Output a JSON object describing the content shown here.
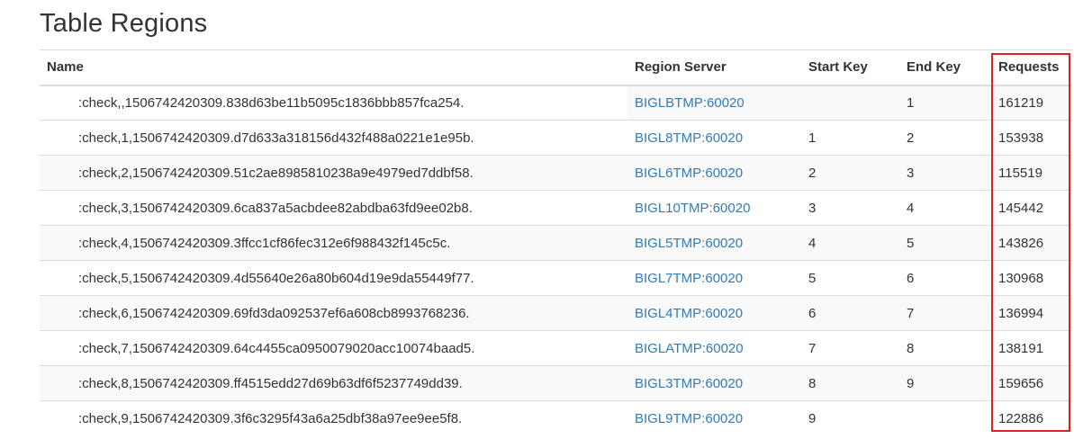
{
  "page_title": "Table Regions",
  "columns": {
    "name": "Name",
    "region_server": "Region Server",
    "start_key": "Start Key",
    "end_key": "End Key",
    "requests": "Requests"
  },
  "rows": [
    {
      "name": ":check,,1506742420309.838d63be11b5095c1836bbb857fca254.",
      "server": "BIGLBTMP:60020",
      "start_key": "",
      "end_key": "1",
      "requests": "161219"
    },
    {
      "name": ":check,1,1506742420309.d7d633a318156d432f488a0221e1e95b.",
      "server": "BIGL8TMP:60020",
      "start_key": "1",
      "end_key": "2",
      "requests": "153938"
    },
    {
      "name": ":check,2,1506742420309.51c2ae8985810238a9e4979ed7ddbf58.",
      "server": "BIGL6TMP:60020",
      "start_key": "2",
      "end_key": "3",
      "requests": "115519"
    },
    {
      "name": ":check,3,1506742420309.6ca837a5acbdee82abdba63fd9ee02b8.",
      "server": "BIGL10TMP:60020",
      "start_key": "3",
      "end_key": "4",
      "requests": "145442"
    },
    {
      "name": ":check,4,1506742420309.3ffcc1cf86fec312e6f988432f145c5c.",
      "server": "BIGL5TMP:60020",
      "start_key": "4",
      "end_key": "5",
      "requests": "143826"
    },
    {
      "name": ":check,5,1506742420309.4d55640e26a80b604d19e9da55449f77.",
      "server": "BIGL7TMP:60020",
      "start_key": "5",
      "end_key": "6",
      "requests": "130968"
    },
    {
      "name": ":check,6,1506742420309.69fd3da092537ef6a608cb8993768236.",
      "server": "BIGL4TMP:60020",
      "start_key": "6",
      "end_key": "7",
      "requests": "136994"
    },
    {
      "name": ":check,7,1506742420309.64c4455ca0950079020acc10074baad5.",
      "server": "BIGLATMP:60020",
      "start_key": "7",
      "end_key": "8",
      "requests": "138191"
    },
    {
      "name": ":check,8,1506742420309.ff4515edd27d69b63df6f5237749dd39.",
      "server": "BIGL3TMP:60020",
      "start_key": "8",
      "end_key": "9",
      "requests": "159656"
    },
    {
      "name": ":check,9,1506742420309.3f6c3295f43a6a25dbf38a97ee9ee5f8.",
      "server": "BIGL9TMP:60020",
      "start_key": "9",
      "end_key": "",
      "requests": "122886"
    }
  ],
  "colors": {
    "link": "#337ab7",
    "highlight_border": "#e02020",
    "stripe": "#f9f9f9"
  }
}
